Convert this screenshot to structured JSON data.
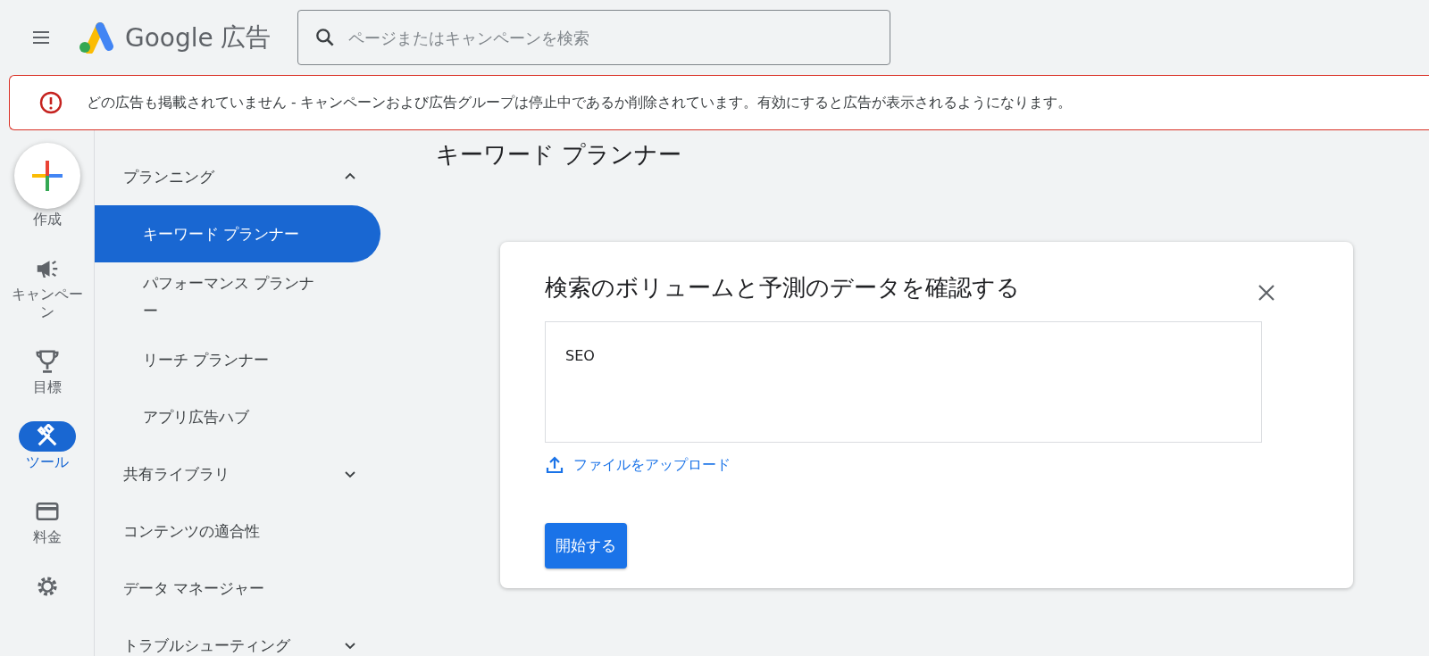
{
  "header": {
    "product": "Google",
    "product_suffix": "広告",
    "search": {
      "placeholder": "ページまたはキャンペーンを検索"
    }
  },
  "alert": {
    "message": "どの広告も掲載されていません - キャンペーンおよび広告グループは停止中であるか削除されています。有効にすると広告が表示されるようになります。"
  },
  "rail": {
    "items": [
      {
        "kind": "create",
        "label": "作成"
      },
      {
        "kind": "campaign",
        "label": "キャンペーン",
        "selected": false
      },
      {
        "kind": "goal",
        "label": "目標",
        "selected": false
      },
      {
        "kind": "tools",
        "label": "ツール",
        "selected": true
      },
      {
        "kind": "billing",
        "label": "料金",
        "selected": false
      },
      {
        "kind": "admin",
        "selected": false
      }
    ]
  },
  "nav": {
    "sections": [
      {
        "label": "プランニング",
        "expanded": true,
        "children": [
          {
            "label": "キーワード プランナー",
            "selected": true
          },
          {
            "label": "パフォーマンス プランナー",
            "selected": false
          },
          {
            "label": "リーチ プランナー",
            "selected": false
          },
          {
            "label": "アプリ広告ハブ",
            "selected": false
          }
        ]
      },
      {
        "label": "共有ライブラリ",
        "expanded": false
      },
      {
        "label": "コンテンツの適合性"
      },
      {
        "label": "データ マネージャー"
      },
      {
        "label": "トラブルシューティング",
        "expanded": false
      }
    ]
  },
  "page": {
    "title": "キーワード プランナー"
  },
  "dialog": {
    "title": "検索のボリュームと予測のデータを確認する",
    "keywords": "SEO",
    "upload_link": "ファイルをアップロード",
    "start_button": "開始する"
  }
}
